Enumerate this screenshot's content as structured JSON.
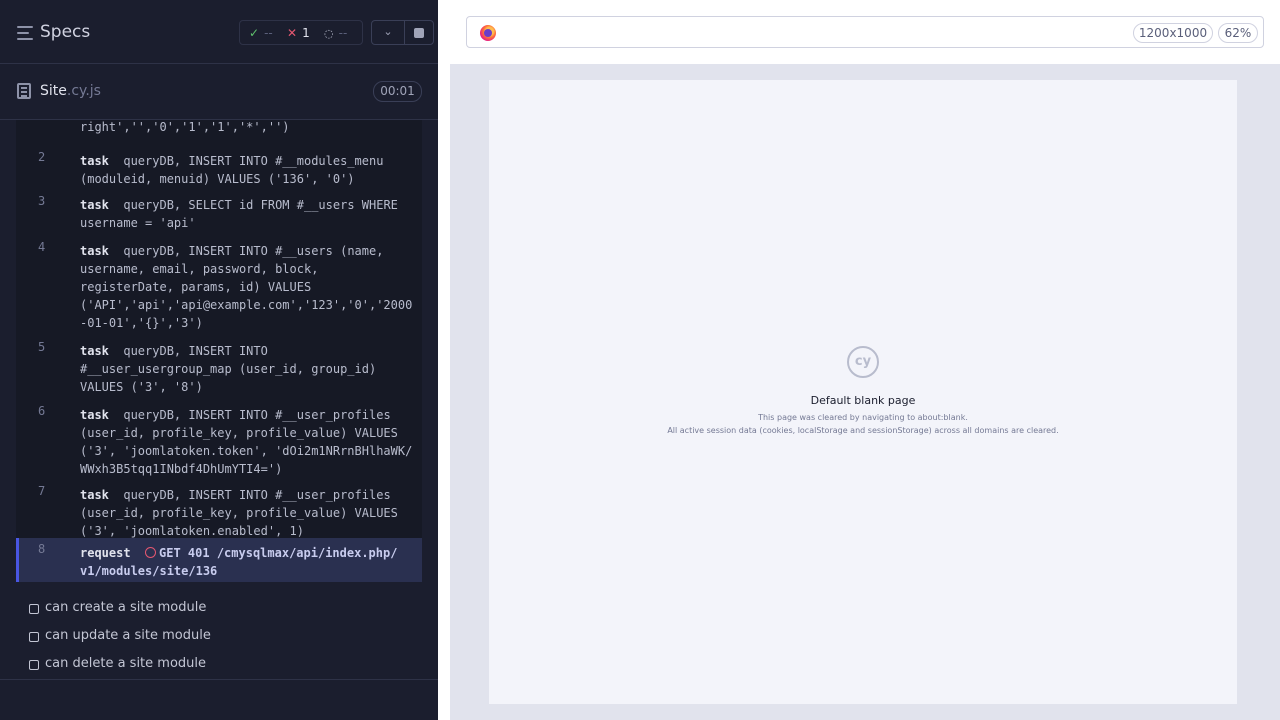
{
  "header": {
    "title": "Specs",
    "stats": {
      "passed": "--",
      "failed": "1",
      "pending": "--"
    }
  },
  "spec": {
    "name": "Site",
    "ext": ".cy.js",
    "duration": "00:01"
  },
  "commands": [
    {
      "number": "",
      "lines": [
        "right','','0','1','1','*','')"
      ]
    },
    {
      "number": "2",
      "keyword": "task",
      "lines": [
        "queryDB, INSERT INTO #__modules_menu",
        "(moduleid, menuid) VALUES ('136', '0')"
      ]
    },
    {
      "number": "3",
      "keyword": "task",
      "lines": [
        "queryDB, SELECT id FROM #__users WHERE",
        "username = 'api'"
      ]
    },
    {
      "number": "4",
      "keyword": "task",
      "lines": [
        "queryDB, INSERT INTO #__users (name,",
        "username, email, password, block,",
        "registerDate, params, id) VALUES",
        "('API','api','api@example.com','123','0','2000",
        "-01-01','{}','3')"
      ]
    },
    {
      "number": "5",
      "keyword": "task",
      "lines": [
        "queryDB, INSERT INTO",
        "#__user_usergroup_map (user_id, group_id)",
        "VALUES ('3', '8')"
      ]
    },
    {
      "number": "6",
      "keyword": "task",
      "lines": [
        "queryDB, INSERT INTO #__user_profiles",
        "(user_id, profile_key, profile_value) VALUES",
        "('3', 'joomlatoken.token', 'dOi2m1NRrnBHlhaWK/",
        "WWxh3B5tqq1INbdf4DhUmYTI4=')"
      ]
    },
    {
      "number": "7",
      "keyword": "task",
      "lines": [
        "queryDB, INSERT INTO #__user_profiles",
        "(user_id, profile_key, profile_value) VALUES",
        "('3', 'joomlatoken.enabled', 1)"
      ]
    },
    {
      "number": "8",
      "keyword": "request",
      "lines": [
        "GET 401 /cmysqlmax/api/index.php/",
        "v1/modules/site/136"
      ]
    }
  ],
  "tests": [
    {
      "label": "can create a site module"
    },
    {
      "label": "can update a site module"
    },
    {
      "label": "can delete a site module"
    }
  ],
  "browser": {
    "viewport_size": "1200x1000",
    "zoom": "62%",
    "icon": "firefox-icon"
  },
  "blank_page": {
    "title": "Default blank page",
    "line1": "This page was cleared by navigating to about:blank.",
    "line2": "All active session data (cookies, localStorage and sessionStorage) across all domains are cleared."
  },
  "colors": {
    "pass": "#5fc06d",
    "fail": "#e45770",
    "accent": "#4956e3"
  }
}
